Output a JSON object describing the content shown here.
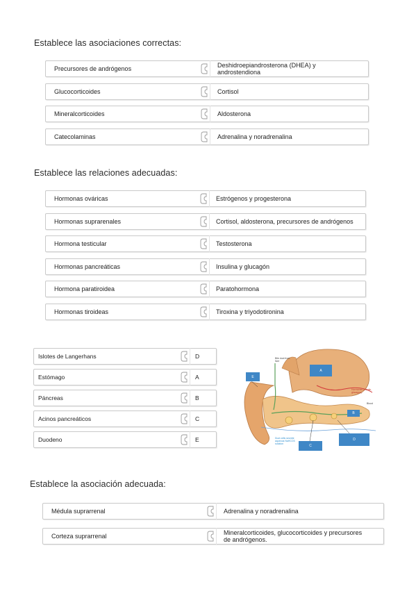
{
  "sections": [
    {
      "title": "Establece las asociaciones correctas:",
      "rows": [
        {
          "left": "Precursores de andrógenos",
          "right": "Deshidroepiandrosterona (DHEA) y androstendiona"
        },
        {
          "left": "Glucocorticoides",
          "right": "Cortisol"
        },
        {
          "left": "Mineralcorticoides",
          "right": "Aldosterona"
        },
        {
          "left": "Catecolaminas",
          "right": "Adrenalina y noradrenalina"
        }
      ]
    },
    {
      "title": "Establece las relaciones adecuadas:",
      "rows": [
        {
          "left": "Hormonas ováricas",
          "right": "Estrógenos y progesterona"
        },
        {
          "left": "Hormonas suprarenales",
          "right": "Cortisol, aldosterona, precursores de andrógenos"
        },
        {
          "left": "Hormona testicular",
          "right": "Testosterona"
        },
        {
          "left": "Hormonas pancreáticas",
          "right": "Insulina y glucagón"
        },
        {
          "left": "Hormona paratiroidea",
          "right": "Paratohormona"
        },
        {
          "left": "Hormonas tiroideas",
          "right": "Tiroxina y triyodotironina"
        }
      ]
    },
    {
      "title": "",
      "rows": [
        {
          "left": "Islotes de Langerhans",
          "right": "D"
        },
        {
          "left": "Estómago",
          "right": "A"
        },
        {
          "left": "Páncreas",
          "right": "B"
        },
        {
          "left": "Acinos pancreáticos",
          "right": "C"
        },
        {
          "left": "Duodeno",
          "right": "E"
        }
      ]
    },
    {
      "title": "Establece la asociación adecuada:",
      "rows": [
        {
          "left": "Médula suprarrenal",
          "right": "Adrenalina y noradrenalina"
        },
        {
          "left": "Corteza suprarrenal",
          "right": "Mineralcorticoides, glucocorticoides y precursores de andrógenos."
        }
      ]
    }
  ],
  "figure": {
    "labels": {
      "a": "A",
      "b": "B",
      "c": "C",
      "d": "D",
      "e": "E"
    },
    "small_text": {
      "bile_duct": "Bile duct from liver",
      "hormone": "Hormones (insulin, glucagon)",
      "blood": "Blood",
      "delta": "Duct cells secrete aqueous NaHCO3 solution"
    },
    "colors": {
      "label_box": "#3f87c6",
      "organ": "#e8b07a",
      "pancreas": "#f0c48a",
      "vessel": "#d33a3a"
    }
  }
}
